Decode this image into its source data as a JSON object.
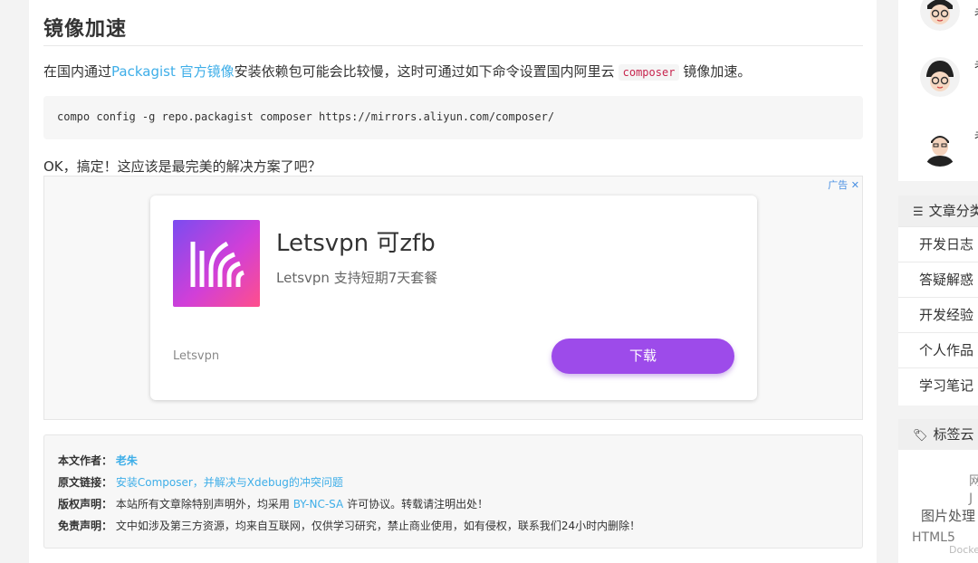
{
  "article": {
    "heading": "镜像加速",
    "para1": {
      "before": "在国内通过",
      "link": "Packagist 官方镜像",
      "middle": "安装依赖包可能会比较慢，这时可通过如下命令设置国内阿里云",
      "code": "composer",
      "after": "镜像加速。"
    },
    "code_line": "compo config -g repo.packagist composer https://mirrors.aliyun.com/composer/",
    "para2": "OK，搞定！这应该是最完美的解决方案了吧？"
  },
  "ad": {
    "tag": "广告",
    "close": "✕",
    "title": "Letsvpn 可zfb",
    "subtitle": "Letsvpn 支持短期7天套餐",
    "brand": "Letsvpn",
    "button": "下载",
    "colors": {
      "button": "#9d4bea",
      "logo_from": "#7b4cf0",
      "logo_to": "#ff4f8b"
    }
  },
  "info": {
    "author_label": "本文作者：",
    "author": "老朱",
    "link_label": "原文链接：",
    "link": "安装Composer，并解决与Xdebug的冲突问题",
    "copyright_label": "版权声明：",
    "copyright_before": "本站所有文章除特别声明外，均采用",
    "license": "BY-NC-SA",
    "copyright_after": "许可协议。转载请注明出处！",
    "disclaimer_label": "免责声明：",
    "disclaimer": "文中如涉及第三方资源，均来自互联网，仅供学习研究，禁止商业使用，如有侵权，联系我们24小时内删除！"
  },
  "sidebar": {
    "users": [
      {
        "text": "老"
      },
      {
        "text": "老"
      },
      {
        "text": "老"
      }
    ],
    "categories": {
      "title": "文章分类",
      "icon": "list-icon",
      "items": [
        "开发日志",
        "答疑解惑",
        "开发经验",
        "个人作品",
        "学习笔记"
      ]
    },
    "tags": {
      "title": "标签云",
      "icon": "tag-icon",
      "items": [
        "网",
        "J",
        "图片处理",
        "HTML5",
        "Docker"
      ]
    }
  }
}
